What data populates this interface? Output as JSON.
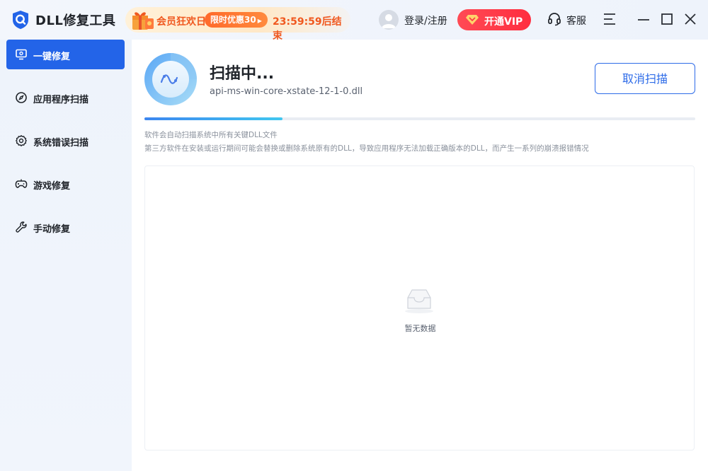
{
  "app": {
    "title": "DLL修复工具"
  },
  "promo": {
    "title": "会员狂欢日",
    "pill": "限时优惠30",
    "countdown": "23:59:59后结束"
  },
  "header": {
    "login_label": "登录/注册",
    "vip_label": "开通VIP",
    "service_label": "客服"
  },
  "sidebar": {
    "items": [
      {
        "label": "一键修复",
        "icon": "monitor-icon",
        "active": true
      },
      {
        "label": "应用程序扫描",
        "icon": "compass-icon",
        "active": false
      },
      {
        "label": "系统错误扫描",
        "icon": "gear-icon",
        "active": false
      },
      {
        "label": "游戏修复",
        "icon": "gamepad-icon",
        "active": false
      },
      {
        "label": "手动修复",
        "icon": "wrench-icon",
        "active": false
      }
    ]
  },
  "scan": {
    "title": "扫描中...",
    "current_file": "api-ms-win-core-xstate-12-1-0.dll",
    "cancel_label": "取消扫描",
    "progress": 0.25
  },
  "description": {
    "line1": "软件会自动扫描系统中所有关键DLL文件",
    "line2": "第三方软件在安装或运行期间可能会替换或删除系统原有的DLL，导致应用程序无法加载正确版本的DLL，而产生一系列的崩溃报错情况"
  },
  "results": {
    "empty_text": "暂无数据"
  },
  "colors": {
    "primary": "#2364e8",
    "vip": "#ff3446",
    "promo_accent": "#f0581f"
  }
}
